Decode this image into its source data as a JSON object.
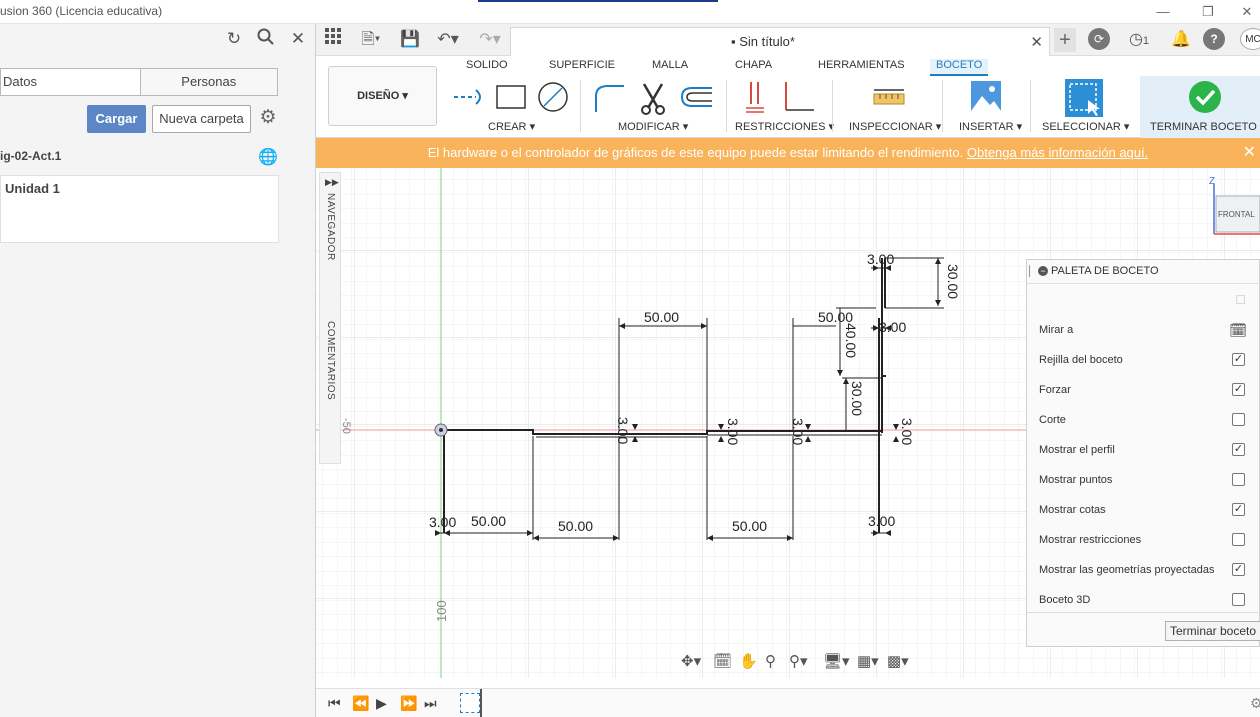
{
  "window": {
    "title": "usion 360 (Licencia educativa)"
  },
  "left_panel": {
    "tabs": [
      "Datos",
      "Personas"
    ],
    "upload_label": "Cargar",
    "new_folder_label": "Nueva carpeta",
    "project_name": "ig-02-Act.1",
    "unit_label": "Unidad 1"
  },
  "app_bar": {
    "document_title": "Sin título*",
    "notification_count": "1",
    "user_initials": "MC"
  },
  "ribbon": {
    "design_label": "DISEÑO",
    "tabs": [
      "SOLIDO",
      "SUPERFICIE",
      "MALLA",
      "CHAPA",
      "HERRAMIENTAS",
      "BOCETO"
    ],
    "groups": [
      "CREAR",
      "MODIFICAR",
      "RESTRICCIONES",
      "INSPECCIONAR",
      "INSERTAR",
      "SELECCIONAR",
      "TERMINAR BOCETO"
    ]
  },
  "warning": {
    "text": "El hardware o el controlador de gráficos de este equipo puede estar limitando el rendimiento.",
    "link": "Obtenga más información aquí."
  },
  "side_tabs": {
    "navigator": "NAVEGADOR",
    "comments": "COMENTARIOS"
  },
  "viewcube": {
    "face": "FRONTAL",
    "axis": "Z"
  },
  "canvas_axis_labels": {
    "vertical_100": "100",
    "horizontal_cut": "-50"
  },
  "dimensions": {
    "d1": "3.00",
    "d2": "30.00",
    "d3": "50.00",
    "d4": "50.00",
    "d5": "40.00",
    "d6": "3.00",
    "d7": "30.00",
    "d8": "3.00",
    "d9": "3.00",
    "d10": "3.00",
    "d11": "3.00",
    "d12": "3.00",
    "d13": "50.00",
    "d14": "50.00",
    "d15": "50.00",
    "d16": "3.00"
  },
  "palette": {
    "title": "PALETA DE BOCETO",
    "rows": [
      {
        "label": "Mirar a",
        "type": "icon"
      },
      {
        "label": "Rejilla del boceto",
        "checked": true
      },
      {
        "label": "Forzar",
        "checked": true
      },
      {
        "label": "Corte",
        "checked": false
      },
      {
        "label": "Mostrar el perfil",
        "checked": true
      },
      {
        "label": "Mostrar puntos",
        "checked": false
      },
      {
        "label": "Mostrar cotas",
        "checked": true
      },
      {
        "label": "Mostrar restricciones",
        "checked": false
      },
      {
        "label": "Mostrar las geometrías proyectadas",
        "checked": true
      },
      {
        "label": "Boceto 3D",
        "checked": false
      }
    ],
    "finish_label": "Terminar boceto"
  },
  "colors": {
    "accent": "#1f7ec2",
    "warning": "#f9b35a",
    "upload": "#5b87c7",
    "finish_green": "#2cb34a",
    "axis_red": "#e44b4b",
    "axis_green": "#4caf50"
  }
}
